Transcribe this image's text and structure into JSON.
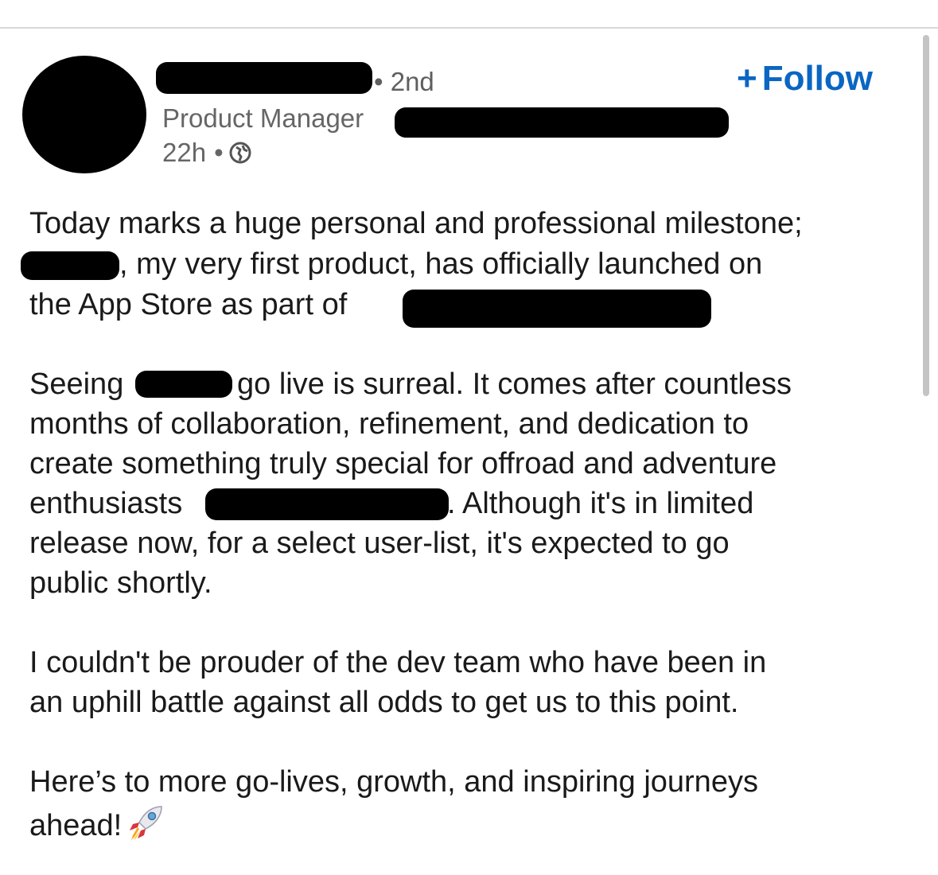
{
  "post": {
    "author": {
      "degree": "• 2nd",
      "headline": "Product Manager",
      "time": "22h",
      "separator": "•",
      "visibility_icon": "globe-icon"
    },
    "follow_label": "Follow",
    "follow_icon": "plus-icon",
    "body": {
      "p1_l1": "Today marks a huge personal and professional milestone;",
      "p1_l2": ", my very first product, has officially launched on",
      "p1_l3": "the App Store as part of",
      "p2_l1a": "Seeing",
      "p2_l1b": "go live is surreal. It comes after countless",
      "p2_l2": "months of collaboration, refinement, and dedication to",
      "p2_l3": "create something truly special for offroad and adventure",
      "p2_l4a": "enthusiasts",
      "p2_l4b": ". Although it's in limited",
      "p2_l5": "release now, for a select user-list, it's expected to go",
      "p2_l6": "public shortly.",
      "p3_l1": "I couldn't be prouder of the dev team who have been in",
      "p3_l2": "an uphill battle against all odds to get us to this point.",
      "p4_l1": "Here’s to more go-lives, growth, and inspiring journeys",
      "p4_l2": "ahead!",
      "emoji_icon": "rocket-icon"
    }
  },
  "colors": {
    "accent": "#0a66c2",
    "text": "#1a1a1a",
    "secondary_text": "#666666",
    "redaction": "#000000"
  }
}
